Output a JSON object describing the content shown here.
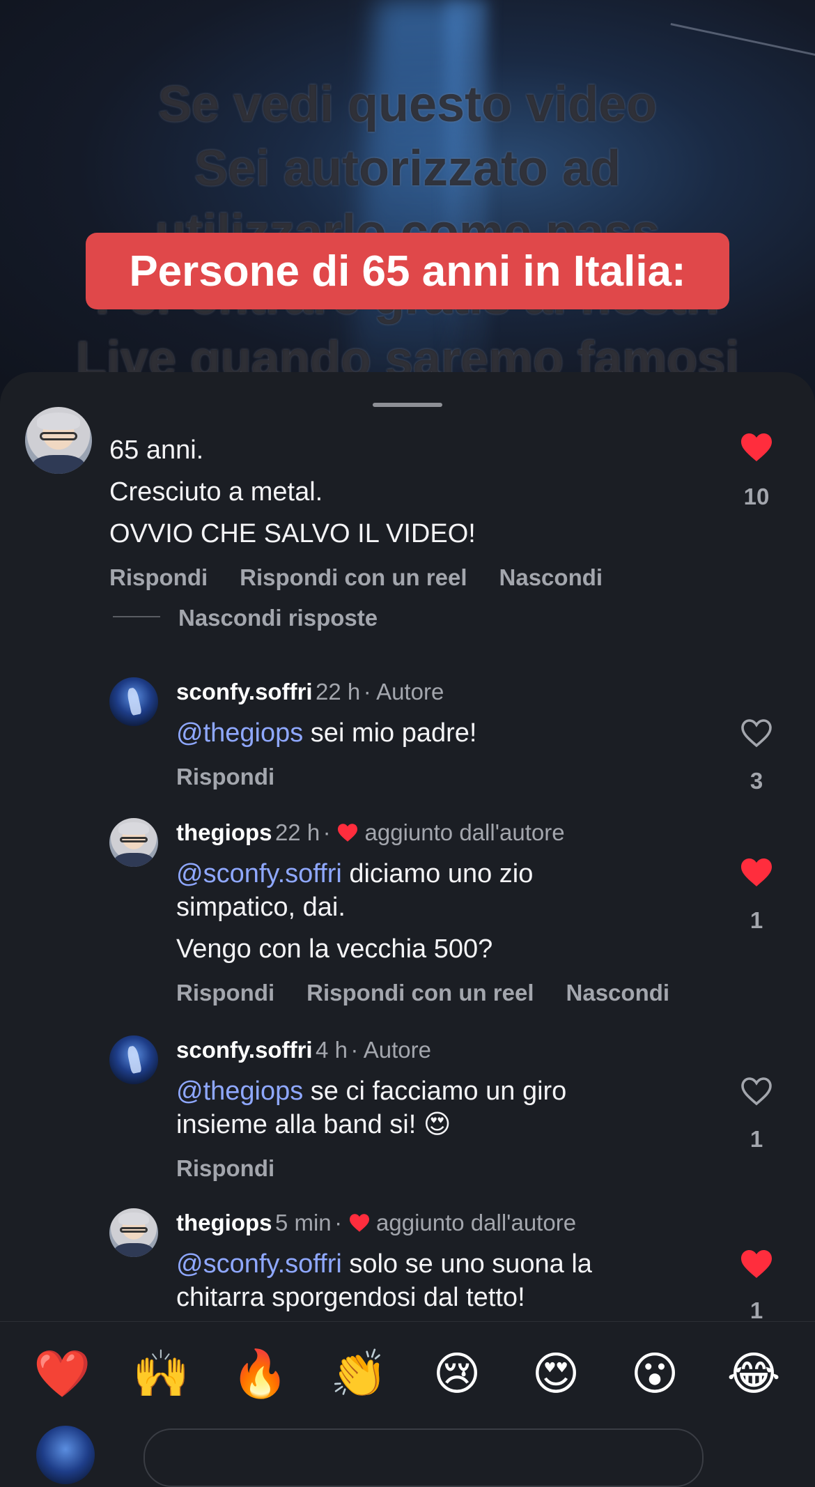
{
  "video": {
    "overlay_lines": [
      "Se vedi questo video",
      "Sei autorizzato ad",
      "utilizzarlo come pass",
      "Per entrare gratis ai nostri",
      "Live quando saremo famosi"
    ],
    "caption": "Persone di 65 anni in Italia:"
  },
  "comments": {
    "main": {
      "lines": [
        "65 anni.",
        "Cresciuto a metal.",
        "OVVIO CHE SALVO IL VIDEO!"
      ],
      "likes": "10",
      "actions": [
        "Rispondi",
        "Rispondi con un reel",
        "Nascondi"
      ],
      "hide_replies": "Nascondi risposte"
    },
    "replies": [
      {
        "username": "sconfy.soffri",
        "time": "22 h",
        "tag": "· Autore",
        "mention": "@thegiops",
        "text": " sei mio padre!",
        "actions": [
          "Rispondi"
        ],
        "likes": "3"
      },
      {
        "username": "thegiops",
        "time": "22 h",
        "tag_prefix": "·",
        "tag": "aggiunto dall'autore",
        "mention": "@sconfy.soffri",
        "text": " diciamo uno zio",
        "line2": "simpatico, dai.",
        "line3": "Vengo con la vecchia 500?",
        "actions": [
          "Rispondi",
          "Rispondi con un reel",
          "Nascondi"
        ],
        "likes": "1"
      },
      {
        "username": "sconfy.soffri",
        "time": "4 h",
        "tag": "· Autore",
        "mention": "@thegiops",
        "text": " se ci facciamo un giro",
        "line2": "insieme alla band si! 😍",
        "actions": [
          "Rispondi"
        ],
        "likes": "1"
      },
      {
        "username": "thegiops",
        "time": "5 min",
        "tag_prefix": "·",
        "tag": "aggiunto dall'autore",
        "mention": "@sconfy.soffri",
        "text": " solo se uno suona la",
        "line2": "chitarra sporgendosi dal tetto!",
        "likes": "1"
      }
    ]
  },
  "emoji_bar": [
    "❤️",
    "🙌",
    "🔥",
    "👏",
    "😢",
    "😍",
    "😮",
    "😂"
  ],
  "colors": {
    "like_red": "#ff2d3d",
    "mention_blue": "#8fa8ff",
    "banner_red": "#e0484a"
  }
}
